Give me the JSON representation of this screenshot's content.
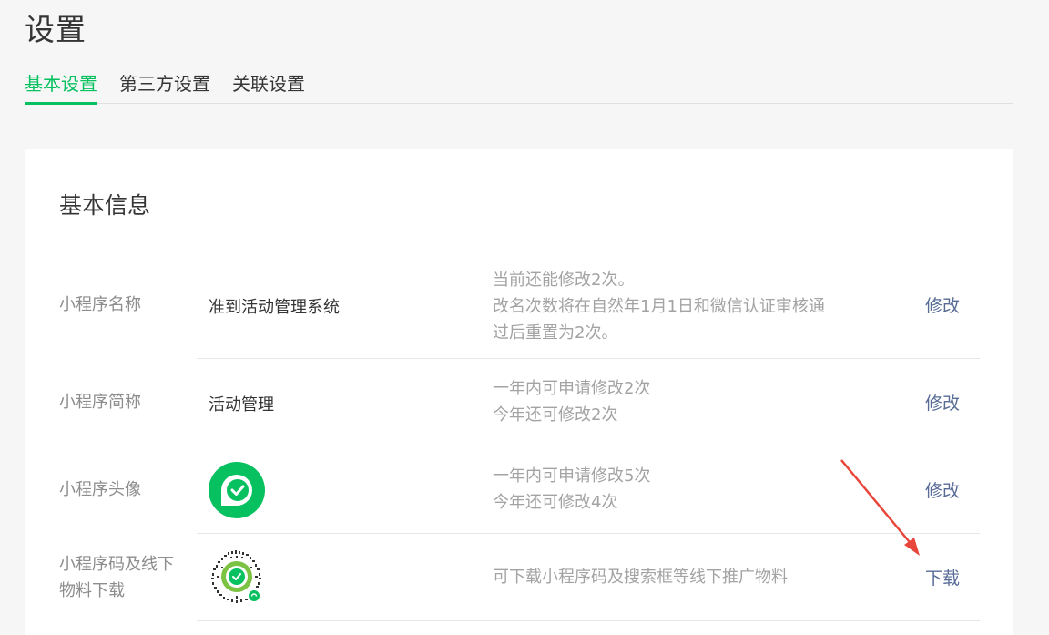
{
  "page": {
    "title": "设置"
  },
  "tabs": [
    {
      "label": "基本设置"
    },
    {
      "label": "第三方设置"
    },
    {
      "label": "关联设置"
    }
  ],
  "card": {
    "title": "基本信息"
  },
  "rows": [
    {
      "label": "小程序名称",
      "value": "准到活动管理系统",
      "desc": [
        "当前还能修改2次。",
        "改名次数将在自然年1月1日和微信认证审核通",
        "过后重置为2次。"
      ],
      "action": "修改"
    },
    {
      "label": "小程序简称",
      "value": "活动管理",
      "desc": [
        "一年内可申请修改2次",
        "今年还可修改2次"
      ],
      "action": "修改"
    },
    {
      "label": "小程序头像",
      "value_icon": "mini-program-avatar-icon",
      "desc": [
        "一年内可申请修改5次",
        "今年还可修改4次"
      ],
      "action": "修改"
    },
    {
      "label": [
        "小程序码及线下",
        "物料下载"
      ],
      "value_icon": "mini-program-code-icon",
      "desc": [
        "可下载小程序码及搜索框等线下推广物料"
      ],
      "action": "下载"
    }
  ],
  "colors": {
    "accent": "#07c160",
    "link": "#576b95",
    "annotation_arrow": "#e8463a"
  }
}
